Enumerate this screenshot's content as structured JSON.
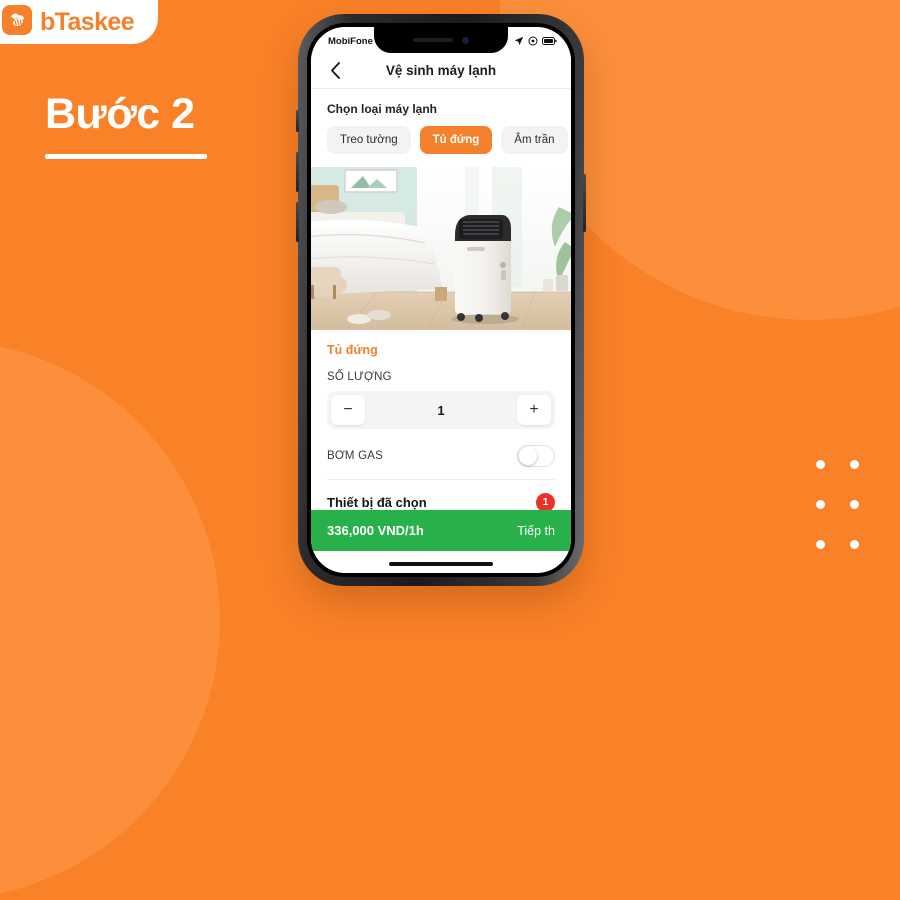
{
  "brand": {
    "name": "bTaskee",
    "logo_icon": "bee-icon",
    "accent_color": "#f5812c"
  },
  "banner": {
    "step_title": "Bước 2"
  },
  "phone": {
    "status_bar": {
      "carrier": "MobiFone",
      "wifi_icon": "wifi-icon",
      "location_icon": "location-arrow-icon",
      "rotation_icon": "rotation-lock-icon",
      "battery_icon": "battery-icon"
    },
    "nav": {
      "back_icon": "chevron-left-icon",
      "title": "Vệ sinh máy lạnh"
    },
    "section": {
      "label": "Chọn loại máy lạnh",
      "chips": [
        {
          "label": "Treo tường",
          "selected": false
        },
        {
          "label": "Tủ đứng",
          "selected": true
        },
        {
          "label": "Âm trần",
          "selected": false
        }
      ]
    },
    "hero": {
      "alt": "portable-air-conditioner-in-bedroom"
    },
    "detail": {
      "type_name": "Tủ đứng",
      "quantity_label": "SỐ LƯỢNG",
      "quantity_value": "1",
      "decrement_label": "−",
      "increment_label": "+",
      "option_label": "BƠM GAS",
      "option_enabled": false
    },
    "selected_devices": {
      "label": "Thiết bị đã chọn",
      "count": "1",
      "badge_color": "#e8332a"
    },
    "cta": {
      "price": "336,000 VND/1h",
      "next_label": "Tiếp th",
      "bar_color": "#28b04b"
    }
  }
}
